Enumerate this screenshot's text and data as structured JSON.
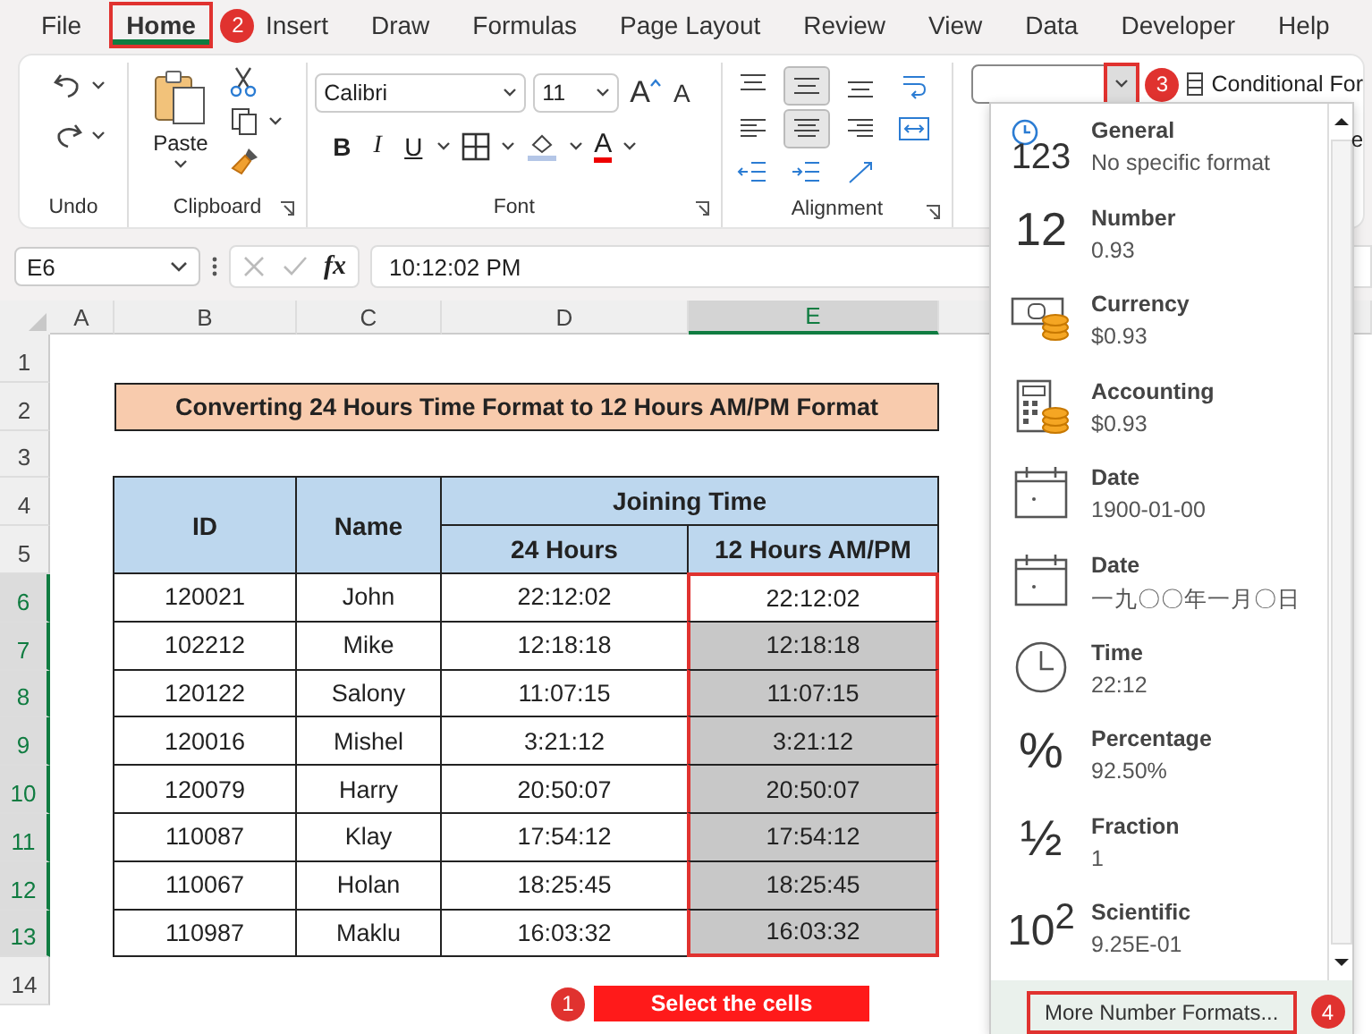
{
  "ribbon": {
    "tabs": [
      {
        "label": "File",
        "selected": false
      },
      {
        "label": "Home",
        "selected": true
      },
      {
        "label": "Insert",
        "selected": false
      },
      {
        "label": "Draw",
        "selected": false
      },
      {
        "label": "Formulas",
        "selected": false
      },
      {
        "label": "Page Layout",
        "selected": false
      },
      {
        "label": "Review",
        "selected": false
      },
      {
        "label": "View",
        "selected": false
      },
      {
        "label": "Data",
        "selected": false
      },
      {
        "label": "Developer",
        "selected": false
      },
      {
        "label": "Help",
        "selected": false
      }
    ],
    "tab_callout": "2",
    "groups": [
      "Undo",
      "Clipboard",
      "Font",
      "Alignment"
    ],
    "paste_label": "Paste",
    "font_name": "Calibri",
    "font_size": "11",
    "font_glyphs": {
      "grow": "A",
      "shrink": "A",
      "bold": "B",
      "italic": "I",
      "underline": "U",
      "font_a": "A"
    },
    "align_buttons": [
      {
        "kind": "top",
        "selected": false
      },
      {
        "kind": "middle",
        "selected": true
      },
      {
        "kind": "bottom",
        "selected": false
      },
      {
        "kind": "wrap",
        "selected": false
      },
      {
        "kind": "left",
        "selected": false
      },
      {
        "kind": "center",
        "selected": true
      },
      {
        "kind": "right",
        "selected": false
      },
      {
        "kind": "merge",
        "selected": false
      },
      {
        "kind": "outdent",
        "selected": false
      },
      {
        "kind": "indent",
        "selected": false
      },
      {
        "kind": "orient",
        "selected": false
      }
    ],
    "number_format_callout": "3",
    "conditional_label": "Conditional For",
    "hidden_letter": "e"
  },
  "formula_bar": {
    "name_box": "E6",
    "fx": "fx",
    "formula": "10:12:02 PM"
  },
  "sheet": {
    "columns": [
      {
        "label": "A",
        "selected": false
      },
      {
        "label": "B",
        "selected": false
      },
      {
        "label": "C",
        "selected": false
      },
      {
        "label": "D",
        "selected": false
      },
      {
        "label": "E",
        "selected": true
      }
    ],
    "row_numbers": [
      "1",
      "2",
      "3",
      "4",
      "5",
      "6",
      "7",
      "8",
      "9",
      "10",
      "11",
      "12",
      "13",
      "14"
    ],
    "title": "Converting 24 Hours Time Format to 12 Hours AM/PM Format",
    "headers": {
      "id": "ID",
      "name": "Name",
      "group": "Joining Time",
      "h24": "24 Hours",
      "h12": "12 Hours AM/PM"
    },
    "rows": [
      {
        "id": "120021",
        "name": "John",
        "h24": "22:12:02",
        "h12": "22:12:02",
        "selected": true,
        "active": true
      },
      {
        "id": "102212",
        "name": "Mike",
        "h24": "12:18:18",
        "h12": "12:18:18",
        "selected": true,
        "active": false
      },
      {
        "id": "120122",
        "name": "Salony",
        "h24": "11:07:15",
        "h12": "11:07:15",
        "selected": true,
        "active": false
      },
      {
        "id": "120016",
        "name": "Mishel",
        "h24": "3:21:12",
        "h12": "3:21:12",
        "selected": true,
        "active": false
      },
      {
        "id": "120079",
        "name": "Harry",
        "h24": "20:50:07",
        "h12": "20:50:07",
        "selected": true,
        "active": false
      },
      {
        "id": "110087",
        "name": "Klay",
        "h24": "17:54:12",
        "h12": "17:54:12",
        "selected": true,
        "active": false
      },
      {
        "id": "110067",
        "name": "Holan",
        "h24": "18:25:45",
        "h12": "18:25:45",
        "selected": true,
        "active": false
      },
      {
        "id": "110987",
        "name": "Maklu",
        "h24": "16:03:32",
        "h12": "16:03:32",
        "selected": true,
        "active": false
      }
    ],
    "selection_callout": {
      "number": "1",
      "text": "Select the cells"
    }
  },
  "number_formats": {
    "items": [
      {
        "kind": "general",
        "glyph": "123",
        "title": "General",
        "sample": "No specific format"
      },
      {
        "kind": "number",
        "glyph": "12",
        "title": "Number",
        "sample": "0.93"
      },
      {
        "kind": "currency",
        "title": "Currency",
        "sample": "$0.93"
      },
      {
        "kind": "accounting",
        "title": "Accounting",
        "sample": " $0.93"
      },
      {
        "kind": "date",
        "title": "Date",
        "sample": "1900-01-00"
      },
      {
        "kind": "date",
        "title": "Date",
        "sample": "一九〇〇年一月〇日"
      },
      {
        "kind": "time",
        "title": "Time",
        "sample": "22:12"
      },
      {
        "kind": "percentage",
        "glyph": "%",
        "title": "Percentage",
        "sample": "92.50%"
      },
      {
        "kind": "fraction",
        "glyph": "½",
        "title": "Fraction",
        "sample": "1"
      },
      {
        "kind": "scientific",
        "glyph": "10$^{2}$",
        "title": "Scientific",
        "sample": "9.25E-01"
      }
    ],
    "more": "More Number Formats...",
    "callout": "4"
  }
}
